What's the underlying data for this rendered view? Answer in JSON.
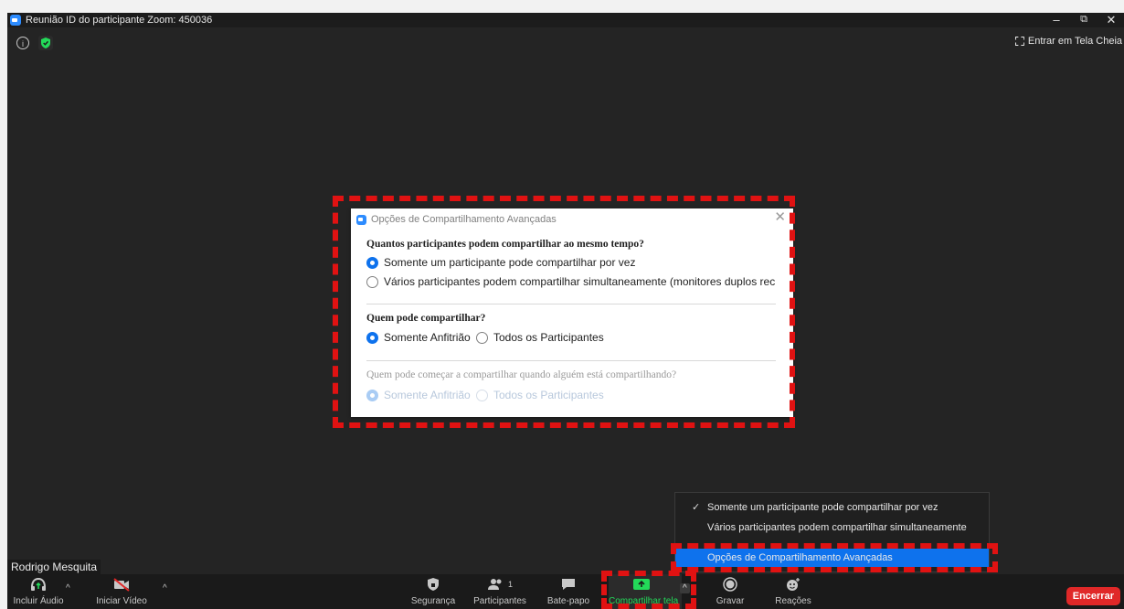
{
  "window": {
    "title": "Reunião ID do participante Zoom: 450036",
    "minimize": "–",
    "restore": "⧉",
    "close": "✕",
    "fullscreen_label": "Entrar em Tela Cheia"
  },
  "dialog": {
    "title": "Opções de Compartilhamento Avançadas",
    "close": "✕",
    "section1": {
      "question": "Quantos participantes podem compartilhar ao mesmo tempo?",
      "options": [
        {
          "label": "Somente um participante pode compartilhar por vez",
          "selected": true
        },
        {
          "label": "Vários participantes podem compartilhar simultaneamente (monitores duplos rec",
          "selected": false
        }
      ]
    },
    "section2": {
      "question": "Quem pode compartilhar?",
      "options": [
        {
          "label": "Somente Anfitrião",
          "selected": true
        },
        {
          "label": "Todos os Participantes",
          "selected": false
        }
      ]
    },
    "section3": {
      "question": "Quem pode começar a compartilhar quando alguém está compartilhando?",
      "options": [
        {
          "label": "Somente Anfitrião",
          "selected": true
        },
        {
          "label": "Todos os Participantes",
          "selected": false
        }
      ],
      "disabled": true
    }
  },
  "participant_name": "Rodrigo Mesquita",
  "share_menu": {
    "items": [
      {
        "label": "Somente um participante pode compartilhar por vez",
        "checked": true
      },
      {
        "label": "Vários participantes podem compartilhar simultaneamente",
        "checked": false
      },
      {
        "label": "Opções de Compartilhamento Avançadas",
        "highlighted": true
      }
    ],
    "check_glyph": "✓"
  },
  "toolbar": {
    "audio": "Incluir Áudio",
    "video": "Iniciar Vídeo",
    "security": "Segurança",
    "participants": "Participantes",
    "participants_count": "1",
    "chat": "Bate-papo",
    "share": "Compartilhar tela",
    "record": "Gravar",
    "reactions": "Reações",
    "end": "Encerrar",
    "caret": "^"
  },
  "colors": {
    "accent": "#0e72ed",
    "share_green": "#23d959",
    "end_red": "#e02828",
    "annotation_red": "#e01212"
  }
}
